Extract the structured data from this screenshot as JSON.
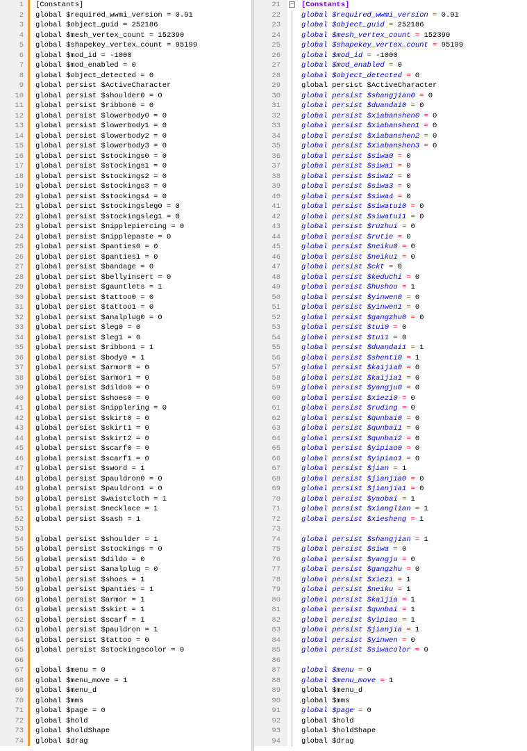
{
  "left_pane": {
    "lines": [
      {
        "n": "1",
        "text": "[Constants]"
      },
      {
        "n": "2",
        "text": "global $required_wwmi_version = 0.91"
      },
      {
        "n": "3",
        "text": "global $object_guid = 252186"
      },
      {
        "n": "4",
        "text": "global $mesh_vertex_count = 152390"
      },
      {
        "n": "5",
        "text": "global $shapekey_vertex_count = 95199"
      },
      {
        "n": "6",
        "text": "global $mod_id = -1000"
      },
      {
        "n": "7",
        "text": "global $mod_enabled = 0"
      },
      {
        "n": "8",
        "text": "global $object_detected = 0"
      },
      {
        "n": "9",
        "text": "global persist $ActiveCharacter"
      },
      {
        "n": "10",
        "text": "global persist $shoulder0 = 0"
      },
      {
        "n": "11",
        "text": "global persist $ribbon0 = 0"
      },
      {
        "n": "12",
        "text": "global persist $lowerbody0 = 0"
      },
      {
        "n": "13",
        "text": "global persist $lowerbody1 = 0"
      },
      {
        "n": "14",
        "text": "global persist $lowerbody2 = 0"
      },
      {
        "n": "15",
        "text": "global persist $lowerbody3 = 0"
      },
      {
        "n": "16",
        "text": "global persist $stockings0 = 0"
      },
      {
        "n": "17",
        "text": "global persist $stockings1 = 0"
      },
      {
        "n": "18",
        "text": "global persist $stockings2 = 0"
      },
      {
        "n": "19",
        "text": "global persist $stockings3 = 0"
      },
      {
        "n": "20",
        "text": "global persist $stockings4 = 0"
      },
      {
        "n": "21",
        "text": "global persist $stockingsleg0 = 0"
      },
      {
        "n": "22",
        "text": "global persist $stockingsleg1 = 0"
      },
      {
        "n": "23",
        "text": "global persist $nipplepiercing = 0"
      },
      {
        "n": "24",
        "text": "global persist $nipplepaste = 0"
      },
      {
        "n": "25",
        "text": "global persist $panties0 = 0"
      },
      {
        "n": "26",
        "text": "global persist $panties1 = 0"
      },
      {
        "n": "27",
        "text": "global persist $bandage = 0"
      },
      {
        "n": "28",
        "text": "global persist $bellyinsert = 0"
      },
      {
        "n": "29",
        "text": "global persist $gauntlets = 1"
      },
      {
        "n": "30",
        "text": "global persist $tattoo0 = 0"
      },
      {
        "n": "31",
        "text": "global persist $tattoo1 = 0"
      },
      {
        "n": "32",
        "text": "global persist $analplug0 = 0"
      },
      {
        "n": "33",
        "text": "global persist $leg0 = 0"
      },
      {
        "n": "34",
        "text": "global persist $leg1 = 0"
      },
      {
        "n": "35",
        "text": "global persist $ribbon1 = 1"
      },
      {
        "n": "36",
        "text": "global persist $body0 = 1"
      },
      {
        "n": "37",
        "text": "global persist $armor0 = 0"
      },
      {
        "n": "38",
        "text": "global persist $armor1 = 0"
      },
      {
        "n": "39",
        "text": "global persist $dildo0 = 0"
      },
      {
        "n": "40",
        "text": "global persist $shoes0 = 0"
      },
      {
        "n": "41",
        "text": "global persist $nipplering = 0"
      },
      {
        "n": "42",
        "text": "global persist $skirt0 = 0"
      },
      {
        "n": "43",
        "text": "global persist $skirt1 = 0"
      },
      {
        "n": "44",
        "text": "global persist $skirt2 = 0"
      },
      {
        "n": "45",
        "text": "global persist $scarf0 = 0"
      },
      {
        "n": "46",
        "text": "global persist $scarf1 = 0"
      },
      {
        "n": "47",
        "text": "global persist $sword = 1"
      },
      {
        "n": "48",
        "text": "global persist $pauldron0 = 0"
      },
      {
        "n": "49",
        "text": "global persist $pauldron1 = 0"
      },
      {
        "n": "50",
        "text": "global persist $waistcloth = 1"
      },
      {
        "n": "51",
        "text": "global persist $necklace = 1"
      },
      {
        "n": "52",
        "text": "global persist $sash = 1"
      },
      {
        "n": "53",
        "text": ""
      },
      {
        "n": "54",
        "text": "global persist $shoulder = 1"
      },
      {
        "n": "55",
        "text": "global persist $stockings = 0"
      },
      {
        "n": "56",
        "text": "global persist $dildo = 0"
      },
      {
        "n": "57",
        "text": "global persist $analplug = 0"
      },
      {
        "n": "58",
        "text": "global persist $shoes = 1"
      },
      {
        "n": "59",
        "text": "global persist $panties = 1"
      },
      {
        "n": "60",
        "text": "global persist $armor = 1"
      },
      {
        "n": "61",
        "text": "global persist $skirt = 1"
      },
      {
        "n": "62",
        "text": "global persist $scarf = 1"
      },
      {
        "n": "63",
        "text": "global persist $pauldron = 1"
      },
      {
        "n": "64",
        "text": "global persist $tattoo = 0"
      },
      {
        "n": "65",
        "text": "global persist $stockingscolor = 0"
      },
      {
        "n": "66",
        "text": ""
      },
      {
        "n": "67",
        "text": "global $menu = 0"
      },
      {
        "n": "68",
        "text": "global $menu_move = 1"
      },
      {
        "n": "69",
        "text": "global $menu_d"
      },
      {
        "n": "70",
        "text": "global $mms"
      },
      {
        "n": "71",
        "text": "global $page = 0"
      },
      {
        "n": "72",
        "text": "global $hold"
      },
      {
        "n": "73",
        "text": "global $holdShape"
      },
      {
        "n": "74",
        "text": "global $drag"
      }
    ]
  },
  "right_pane": {
    "lines": [
      {
        "n": "21",
        "text": "[Constants]",
        "style": "section"
      },
      {
        "n": "22",
        "text": "global $required_wwmi_version = 0.91",
        "style": "italic"
      },
      {
        "n": "23",
        "text": "global $object_guid = 252186",
        "style": "italic"
      },
      {
        "n": "24",
        "text": "global $mesh_vertex_count = 152390",
        "style": "italic"
      },
      {
        "n": "25",
        "text": "global $shapekey_vertex_count = 95199",
        "style": "italic"
      },
      {
        "n": "26",
        "text": "global $mod_id = -1000",
        "style": "italic"
      },
      {
        "n": "27",
        "text": "global $mod_enabled = 0",
        "style": "italic"
      },
      {
        "n": "28",
        "text": "global $object_detected = 0",
        "style": "italic"
      },
      {
        "n": "29",
        "text": "global persist $ActiveCharacter",
        "style": "plain"
      },
      {
        "n": "30",
        "text": "global persist $shangjian0 = 0",
        "style": "italic"
      },
      {
        "n": "31",
        "text": "global persist $duandai0 = 0",
        "style": "italic"
      },
      {
        "n": "32",
        "text": "global persist $xiabanshen0 = 0",
        "style": "italic"
      },
      {
        "n": "33",
        "text": "global persist $xiabanshen1 = 0",
        "style": "italic"
      },
      {
        "n": "34",
        "text": "global persist $xiabanshen2 = 0",
        "style": "italic"
      },
      {
        "n": "35",
        "text": "global persist $xiabanshen3 = 0",
        "style": "italic"
      },
      {
        "n": "36",
        "text": "global persist $siwa0 = 0",
        "style": "italic"
      },
      {
        "n": "37",
        "text": "global persist $siwa1 = 0",
        "style": "italic"
      },
      {
        "n": "38",
        "text": "global persist $siwa2 = 0",
        "style": "italic"
      },
      {
        "n": "39",
        "text": "global persist $siwa3 = 0",
        "style": "italic"
      },
      {
        "n": "40",
        "text": "global persist $siwa4 = 0",
        "style": "italic"
      },
      {
        "n": "41",
        "text": "global persist $siwatui0 = 0",
        "style": "italic"
      },
      {
        "n": "42",
        "text": "global persist $siwatui1 = 0",
        "style": "italic"
      },
      {
        "n": "43",
        "text": "global persist $ruzhui = 0",
        "style": "italic"
      },
      {
        "n": "44",
        "text": "global persist $rutie = 0",
        "style": "italic"
      },
      {
        "n": "45",
        "text": "global persist $neiku0 = 0",
        "style": "italic"
      },
      {
        "n": "46",
        "text": "global persist $neiku1 = 0",
        "style": "italic"
      },
      {
        "n": "47",
        "text": "global persist $ckt = 0",
        "style": "italic"
      },
      {
        "n": "48",
        "text": "global persist $keduchi = 0",
        "style": "italic"
      },
      {
        "n": "49",
        "text": "global persist $hushou = 1",
        "style": "italic"
      },
      {
        "n": "50",
        "text": "global persist $yinwen0 = 0",
        "style": "italic"
      },
      {
        "n": "51",
        "text": "global persist $yinwen1 = 0",
        "style": "italic"
      },
      {
        "n": "52",
        "text": "global persist $gangzhu0 = 0",
        "style": "italic"
      },
      {
        "n": "53",
        "text": "global persist $tui0 = 0",
        "style": "italic"
      },
      {
        "n": "54",
        "text": "global persist $tui1 = 0",
        "style": "italic"
      },
      {
        "n": "55",
        "text": "global persist $duandai1 = 1",
        "style": "italic"
      },
      {
        "n": "56",
        "text": "global persist $shenti0 = 1",
        "style": "italic"
      },
      {
        "n": "57",
        "text": "global persist $kaijia0 = 0",
        "style": "italic"
      },
      {
        "n": "58",
        "text": "global persist $kaijia1 = 0",
        "style": "italic"
      },
      {
        "n": "59",
        "text": "global persist $yangju0 = 0",
        "style": "italic"
      },
      {
        "n": "60",
        "text": "global persist $xiezi0 = 0",
        "style": "italic"
      },
      {
        "n": "61",
        "text": "global persist $ruding = 0",
        "style": "italic"
      },
      {
        "n": "62",
        "text": "global persist $qunbai0 = 0",
        "style": "italic"
      },
      {
        "n": "63",
        "text": "global persist $qunbai1 = 0",
        "style": "italic"
      },
      {
        "n": "64",
        "text": "global persist $qunbai2 = 0",
        "style": "italic"
      },
      {
        "n": "65",
        "text": "global persist $yipiao0 = 0",
        "style": "italic"
      },
      {
        "n": "66",
        "text": "global persist $yipiao1 = 0",
        "style": "italic"
      },
      {
        "n": "67",
        "text": "global persist $jian = 1",
        "style": "italic"
      },
      {
        "n": "68",
        "text": "global persist $jianjia0 = 0",
        "style": "italic"
      },
      {
        "n": "69",
        "text": "global persist $jianjia1 = 0",
        "style": "italic"
      },
      {
        "n": "70",
        "text": "global persist $yaobai = 1",
        "style": "italic"
      },
      {
        "n": "71",
        "text": "global persist $xianglian = 1",
        "style": "italic"
      },
      {
        "n": "72",
        "text": "global persist $xiesheng = 1",
        "style": "italic"
      },
      {
        "n": "73",
        "text": "",
        "style": "plain"
      },
      {
        "n": "74",
        "text": "global persist $shangjian = 1",
        "style": "italic"
      },
      {
        "n": "75",
        "text": "global persist $siwa = 0",
        "style": "italic"
      },
      {
        "n": "76",
        "text": "global persist $yangju = 0",
        "style": "italic"
      },
      {
        "n": "77",
        "text": "global persist $gangzhu = 0",
        "style": "italic"
      },
      {
        "n": "78",
        "text": "global persist $xiezi = 1",
        "style": "italic"
      },
      {
        "n": "79",
        "text": "global persist $neiku = 1",
        "style": "italic"
      },
      {
        "n": "80",
        "text": "global persist $kaijia = 1",
        "style": "italic"
      },
      {
        "n": "81",
        "text": "global persist $qunbai = 1",
        "style": "italic"
      },
      {
        "n": "82",
        "text": "global persist $yipiao = 1",
        "style": "italic"
      },
      {
        "n": "83",
        "text": "global persist $jianjia = 1",
        "style": "italic"
      },
      {
        "n": "84",
        "text": "global persist $yinwen = 0",
        "style": "italic"
      },
      {
        "n": "85",
        "text": "global persist $siwacolor = 0",
        "style": "italic"
      },
      {
        "n": "86",
        "text": "",
        "style": "plain"
      },
      {
        "n": "87",
        "text": "global $menu = 0",
        "style": "italic"
      },
      {
        "n": "88",
        "text": "global $menu_move = 1",
        "style": "italic"
      },
      {
        "n": "89",
        "text": "global $menu_d",
        "style": "plain"
      },
      {
        "n": "90",
        "text": "global $mms",
        "style": "plain"
      },
      {
        "n": "91",
        "text": "global $page = 0",
        "style": "italic"
      },
      {
        "n": "92",
        "text": "global $hold",
        "style": "plain"
      },
      {
        "n": "93",
        "text": "global $holdShape",
        "style": "plain"
      },
      {
        "n": "94",
        "text": "global $drag",
        "style": "plain"
      }
    ]
  },
  "colors": {
    "change_marker": "#f39a2c",
    "keyword_italic": "#0000ff",
    "section_header": "#8000ff",
    "operator": "#ff0000",
    "line_number": "#8a8a8a",
    "gutter_bg": "#f0f0f0"
  },
  "icons": {
    "fold_toggle": "minus-box-icon"
  }
}
